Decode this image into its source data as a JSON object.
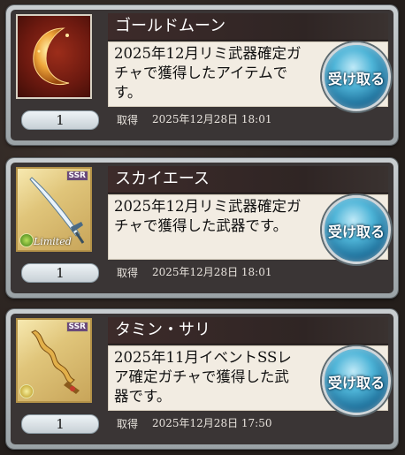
{
  "items": [
    {
      "name": "ゴールドムーン",
      "description": "2025年12月リミ武器確定ガチャで獲得したアイテムです。",
      "quantity": "1",
      "acquired_label": "取得",
      "acquired_date": "2025年12月28日 18:01",
      "button_label": "受け取る",
      "thumb_type": "item",
      "thumb_icon": "golden-crescent-moon",
      "rarity": ""
    },
    {
      "name": "スカイエース",
      "description": "2025年12月リミ武器確定ガチャで獲得した武器です。",
      "quantity": "1",
      "acquired_label": "取得",
      "acquired_date": "2025年12月28日 18:01",
      "button_label": "受け取る",
      "thumb_type": "weapon",
      "thumb_icon": "curved-sword",
      "rarity": "SSR",
      "limited_label": "Limited"
    },
    {
      "name": "タミン・サリ",
      "description": "2025年11月イベントSSレア確定ガチャで獲得した武器です。",
      "quantity": "1",
      "acquired_label": "取得",
      "acquired_date": "2025年12月28日 17:50",
      "button_label": "受け取る",
      "thumb_type": "weapon",
      "thumb_icon": "wavy-kris-dagger",
      "rarity": "SSR"
    }
  ],
  "colors": {
    "button_blue": "#2f8fbf",
    "name_bar": "#3d2b2a",
    "desc_bg": "#f2ece2"
  }
}
